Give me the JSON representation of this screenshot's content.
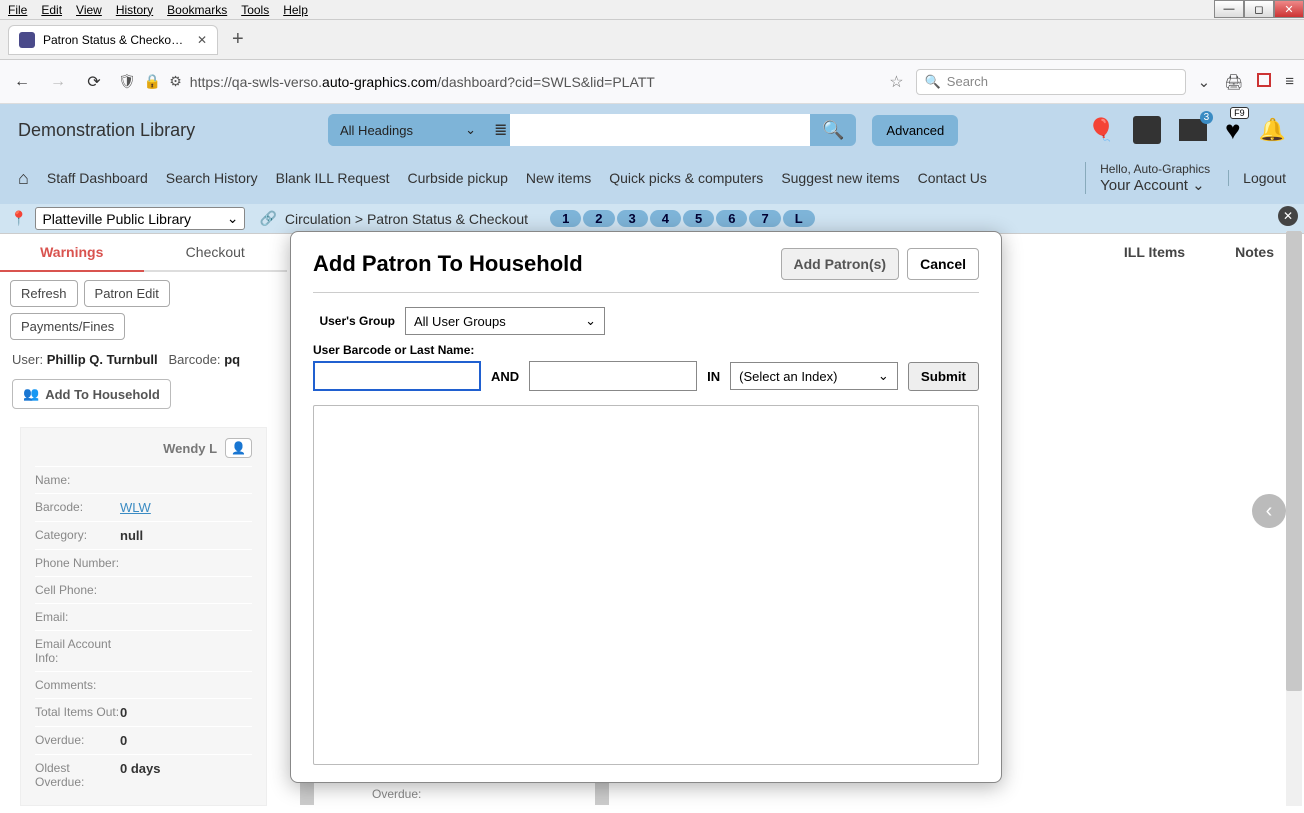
{
  "browser": {
    "menus": [
      "File",
      "Edit",
      "View",
      "History",
      "Bookmarks",
      "Tools",
      "Help"
    ],
    "tab_title": "Patron Status & Checkout | SWL",
    "url_prefix": "https://qa-swls-verso.",
    "url_domain": "auto-graphics.com",
    "url_path": "/dashboard?cid=SWLS&lid=PLATT",
    "search_placeholder": "Search"
  },
  "app": {
    "brand": "Demonstration Library",
    "heading_select": "All Headings",
    "advanced": "Advanced",
    "news_badge": "3",
    "heart_badge": "F9",
    "nav": [
      "Staff Dashboard",
      "Search History",
      "Blank ILL Request",
      "Curbside pickup",
      "New items",
      "Quick picks & computers",
      "Suggest new items",
      "Contact Us"
    ],
    "hello": "Hello, Auto-Graphics",
    "your_account": "Your Account",
    "logout": "Logout"
  },
  "crumb": {
    "library": "Platteville Public Library",
    "path": "Circulation > Patron Status & Checkout",
    "pills": [
      "1",
      "2",
      "3",
      "4",
      "5",
      "6",
      "7",
      "L"
    ]
  },
  "page": {
    "tabs": {
      "warnings": "Warnings",
      "checkout": "Checkout",
      "ill": "ILL Items",
      "notes": "Notes"
    },
    "buttons": {
      "refresh": "Refresh",
      "patron_edit": "Patron Edit",
      "payments": "Payments/Fines"
    },
    "user_label": "User:",
    "user_name": "Phillip Q. Turnbull",
    "barcode_label": "Barcode:",
    "barcode_val": "pq",
    "add_hh": "Add To Household"
  },
  "card": {
    "name_title": "Wendy L",
    "rows": {
      "name": "Name:",
      "barcode": "Barcode:",
      "barcode_val": "WLW",
      "category": "Category:",
      "category_val": "null",
      "phone": "Phone Number:",
      "cell": "Cell Phone:",
      "email": "Email:",
      "email_acct": "Email Account Info:",
      "comments": "Comments:",
      "total_out": "Total Items Out:",
      "total_out_val": "0",
      "overdue": "Overdue:",
      "overdue_val": "0",
      "oldest": "Oldest Overdue:",
      "oldest_val": "0 days"
    }
  },
  "modal": {
    "title": "Add Patron To Household",
    "add_btn": "Add Patron(s)",
    "cancel": "Cancel",
    "group_label": "User's Group",
    "group_val": "All User Groups",
    "barcode_label": "User Barcode or Last Name:",
    "and": "AND",
    "in": "IN",
    "index_val": "(Select an Index)",
    "submit": "Submit"
  },
  "peek": {
    "overdue": "Overdue:"
  }
}
